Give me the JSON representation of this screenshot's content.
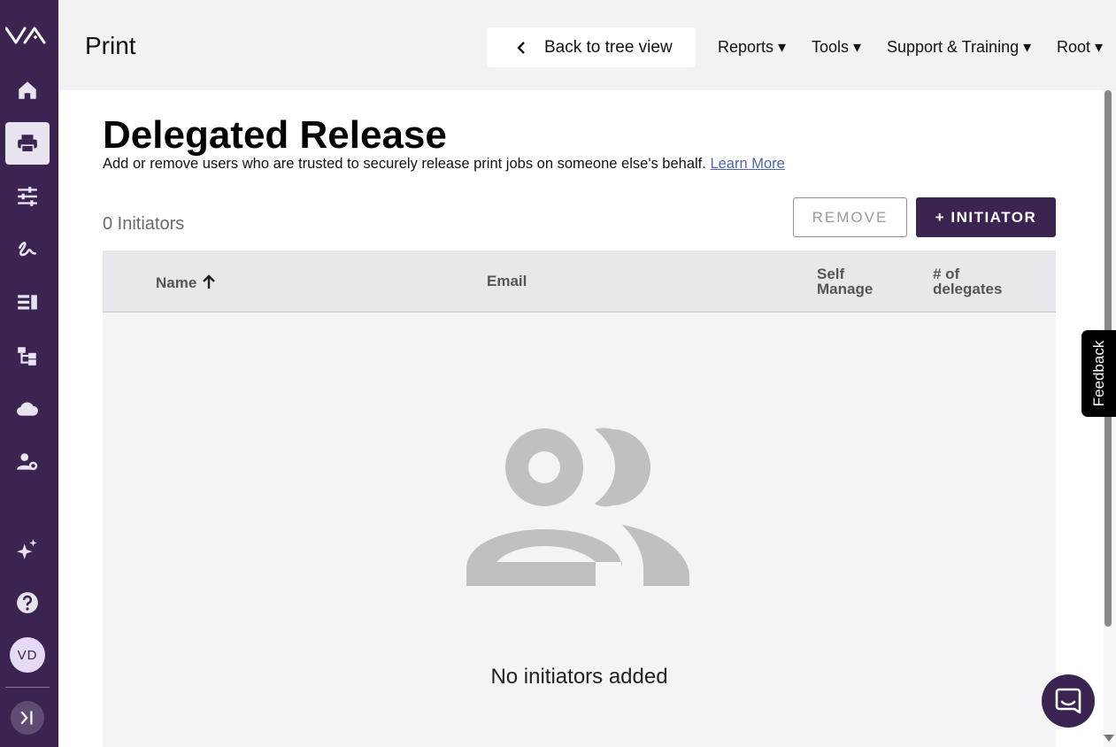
{
  "sidebar": {
    "logo": "va-logo",
    "items": [
      {
        "icon": "home-icon",
        "active": false
      },
      {
        "icon": "printer-icon",
        "active": true
      },
      {
        "icon": "sliders-icon",
        "active": false
      },
      {
        "icon": "signature-icon",
        "active": false
      },
      {
        "icon": "list-icon",
        "active": false
      },
      {
        "icon": "tree-icon",
        "active": false
      },
      {
        "icon": "cloud-icon",
        "active": false
      },
      {
        "icon": "user-settings-icon",
        "active": false
      },
      {
        "icon": "sparkles-icon",
        "active": false
      },
      {
        "icon": "help-icon",
        "active": false
      }
    ],
    "avatar_initials": "VD",
    "collapse_icon": "expand-sidebar-icon"
  },
  "header": {
    "title": "Print",
    "back_button": "Back to tree view",
    "nav": [
      "Reports ▾",
      "Tools ▾",
      "Support & Training ▾",
      "Root ▾"
    ]
  },
  "main": {
    "heading": "Delegated Release",
    "description": "Add or remove users who are trusted to securely release print jobs on someone else's behalf.",
    "learn_more": "Learn More",
    "count_label": "0 Initiators",
    "remove_button": "REMOVE",
    "add_button": "+ INITIATOR",
    "table": {
      "columns": [
        "Name",
        "Email",
        "Self Manage",
        "# of delegates"
      ],
      "sort": {
        "column": "Name",
        "direction": "ascending"
      },
      "rows": [],
      "empty_text": "No initiators added"
    }
  },
  "feedback_tab": "Feedback",
  "colors": {
    "brand": "#3b2352",
    "header_bg": "#f2f1f4",
    "table_head_bg": "#e9e7ec",
    "link": "#4c64b4"
  }
}
